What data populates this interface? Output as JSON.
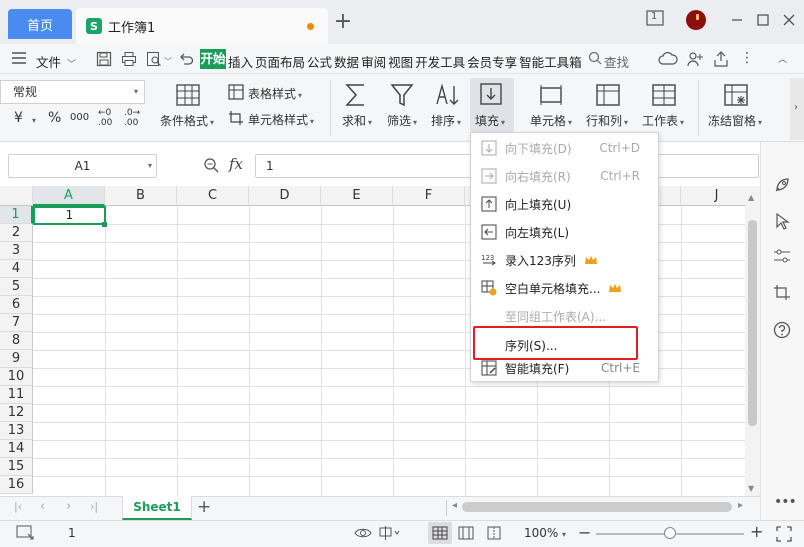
{
  "titlebar": {
    "home_tab": "首页",
    "doc_tab": "工作簿1",
    "doc_icon": "S",
    "new_tab": "+",
    "page_indicator": "1"
  },
  "menu": {
    "file": "文件",
    "tabs": [
      "开始",
      "插入",
      "页面布局",
      "公式",
      "数据",
      "审阅",
      "视图",
      "开发工具",
      "会员专享",
      "智能工具箱"
    ],
    "search": "查找"
  },
  "ribbon": {
    "number_format": "常规",
    "currency": "¥",
    "percent": "%",
    "thousands": "000",
    "dec_add": ".00",
    "dec_remove": ".00",
    "conditional_format": "条件格式",
    "table_style": "表格样式",
    "cell_style": "单元格样式",
    "sum": "求和",
    "filter": "筛选",
    "sort": "排序",
    "fill": "填充",
    "cell": "单元格",
    "rows_cols": "行和列",
    "worksheet": "工作表",
    "freeze": "冻结窗格"
  },
  "formula_bar": {
    "name_box": "A1",
    "fx": "fx",
    "value": "1"
  },
  "grid": {
    "columns": [
      "A",
      "B",
      "C",
      "D",
      "E",
      "F",
      "G",
      "H",
      "I",
      "J"
    ],
    "rows": [
      "1",
      "2",
      "3",
      "4",
      "5",
      "6",
      "7",
      "8",
      "9",
      "10",
      "11",
      "12",
      "13",
      "14",
      "15",
      "16"
    ],
    "a1_value": "1"
  },
  "fill_menu": {
    "items": [
      {
        "label": "向下填充(D)",
        "shortcut": "Ctrl+D",
        "icon": "fill-down-icon",
        "disabled": true
      },
      {
        "label": "向右填充(R)",
        "shortcut": "Ctrl+R",
        "icon": "fill-right-icon",
        "disabled": true
      },
      {
        "label": "向上填充(U)",
        "shortcut": "",
        "icon": "fill-up-icon",
        "disabled": false
      },
      {
        "label": "向左填充(L)",
        "shortcut": "",
        "icon": "fill-left-icon",
        "disabled": false
      },
      {
        "label": "录入123序列",
        "shortcut": "",
        "icon": "sequence-123-icon",
        "disabled": false
      },
      {
        "label": "空白单元格填充...",
        "shortcut": "",
        "icon": "blank-fill-icon",
        "disabled": false
      },
      {
        "label": "至同组工作表(A)...",
        "shortcut": "",
        "icon": "",
        "disabled": true
      },
      {
        "label": "序列(S)...",
        "shortcut": "",
        "icon": "",
        "disabled": false
      },
      {
        "label": "智能填充(F)",
        "shortcut": "Ctrl+E",
        "icon": "smart-fill-icon",
        "disabled": false
      }
    ]
  },
  "sheets": {
    "active": "Sheet1",
    "add": "+"
  },
  "status": {
    "count": "1",
    "zoom": "100%",
    "minus": "−",
    "plus": "+"
  },
  "colors": {
    "accent": "#1a9d59",
    "home_tab": "#4a8bef",
    "highlight": "#e02020",
    "crown": "#f0a020"
  }
}
